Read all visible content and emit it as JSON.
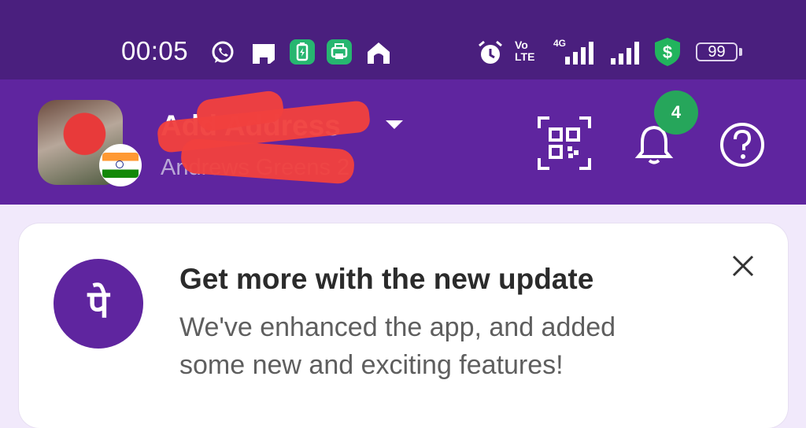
{
  "status_bar": {
    "time": "00:05",
    "volte_line1": "Vo",
    "volte_line2": "LTE",
    "network": "4G",
    "battery": "99",
    "icons": [
      "whatsapp-icon",
      "drive-icon",
      "battery-saver-icon",
      "print-icon",
      "home-icon",
      "alarm-icon",
      "signal-icon",
      "signal-icon",
      "shield-dollar-icon"
    ]
  },
  "header": {
    "address_title": "Add Address",
    "address_subtitle": "Andrews Greens 2",
    "notification_count": "4",
    "icons": [
      "qr-scan-icon",
      "bell-icon",
      "help-icon"
    ]
  },
  "update_card": {
    "title": "Get more with the new update",
    "description": "We've enhanced the app, and added some new and exciting features!",
    "logo_glyph": "पे"
  },
  "colors": {
    "status_bar_bg": "#4a1f7e",
    "header_bg": "#5f259f",
    "page_bg": "#f1e9fb",
    "badge": "#26a65b",
    "redaction": "#f0413e"
  }
}
